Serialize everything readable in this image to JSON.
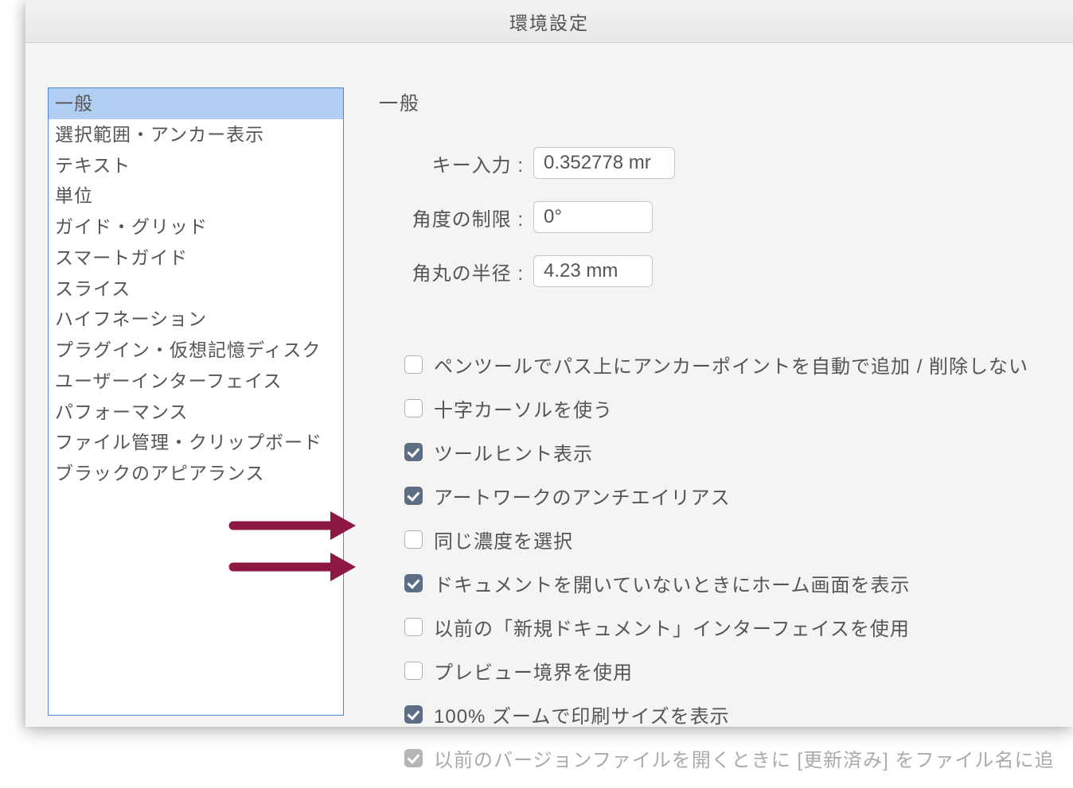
{
  "window": {
    "title": "環境設定"
  },
  "sidebar": {
    "items": [
      "一般",
      "選択範囲・アンカー表示",
      "テキスト",
      "単位",
      "ガイド・グリッド",
      "スマートガイド",
      "スライス",
      "ハイフネーション",
      "プラグイン・仮想記憶ディスク",
      "ユーザーインターフェイス",
      "パフォーマンス",
      "ファイル管理・クリップボード",
      "ブラックのアピアランス"
    ],
    "selected_index": 0
  },
  "main": {
    "heading": "一般",
    "inputs": {
      "key_input": {
        "label": "キー入力 :",
        "value": "0.352778 mr"
      },
      "angle_limit": {
        "label": "角度の制限 :",
        "value": "0°"
      },
      "corner_radius": {
        "label": "角丸の半径 :",
        "value": "4.23 mm"
      }
    },
    "checks": [
      {
        "label": "ペンツールでパス上にアンカーポイントを自動で追加 / 削除しない",
        "checked": false,
        "disabled": false
      },
      {
        "label": "十字カーソルを使う",
        "checked": false,
        "disabled": false
      },
      {
        "label": "ツールヒント表示",
        "checked": true,
        "disabled": false
      },
      {
        "label": "アートワークのアンチエイリアス",
        "checked": true,
        "disabled": false
      },
      {
        "label": "同じ濃度を選択",
        "checked": false,
        "disabled": false
      },
      {
        "label": "ドキュメントを開いていないときにホーム画面を表示",
        "checked": true,
        "disabled": false
      },
      {
        "label": "以前の「新規ドキュメント」インターフェイスを使用",
        "checked": false,
        "disabled": false
      },
      {
        "label": "プレビュー境界を使用",
        "checked": false,
        "disabled": false
      },
      {
        "label": "100% ズームで印刷サイズを表示",
        "checked": true,
        "disabled": false
      },
      {
        "label": "以前のバージョンファイルを開くときに [更新済み] をファイル名に追",
        "checked": true,
        "disabled": true
      }
    ]
  }
}
